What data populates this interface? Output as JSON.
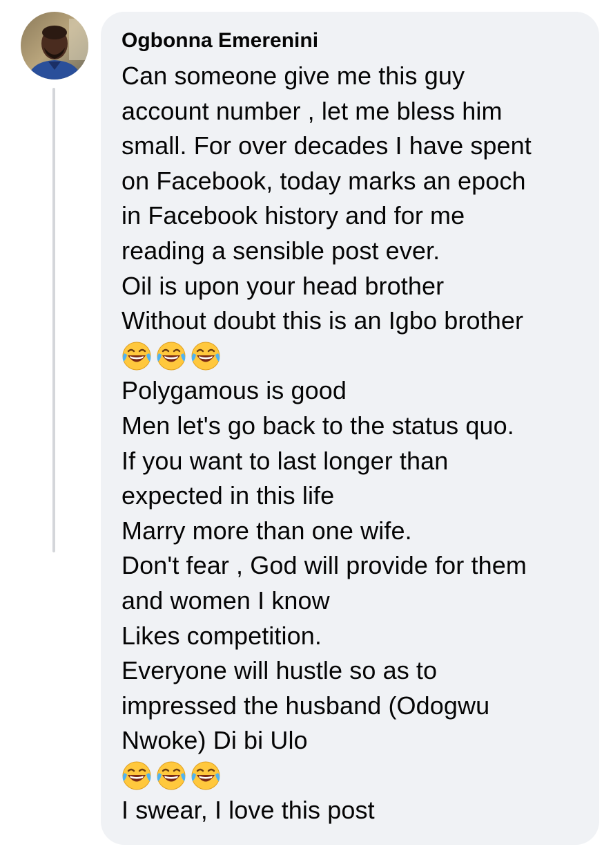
{
  "comment": {
    "author": "Ogbonna Emerenini",
    "lines": [
      "Can someone give me this guy",
      "account number , let me bless him",
      "small. For over decades I have spent",
      "on Facebook, today marks an epoch",
      "in Facebook history and for me",
      "reading a sensible post ever.",
      "Oil is upon your head brother",
      "Without doubt this is an Igbo brother",
      "😂😂😂",
      "Polygamous is good",
      "Men let's go back to the status quo.",
      "If you want to last longer than",
      "expected in this life",
      "Marry more than one wife.",
      "Don't fear , God will provide for them",
      "and women I know",
      "Likes competition.",
      "Everyone will hustle so as to",
      "impressed the husband (Odogwu",
      "Nwoke) Di bi Ulo",
      "😂😂😂",
      "I swear, I love this post"
    ]
  },
  "colors": {
    "bubble": "#f0f2f5",
    "text": "#050505",
    "thread_line": "#d4d6da"
  },
  "icons": {
    "avatar": "profile-photo",
    "emoji": "face-with-tears-of-joy"
  }
}
